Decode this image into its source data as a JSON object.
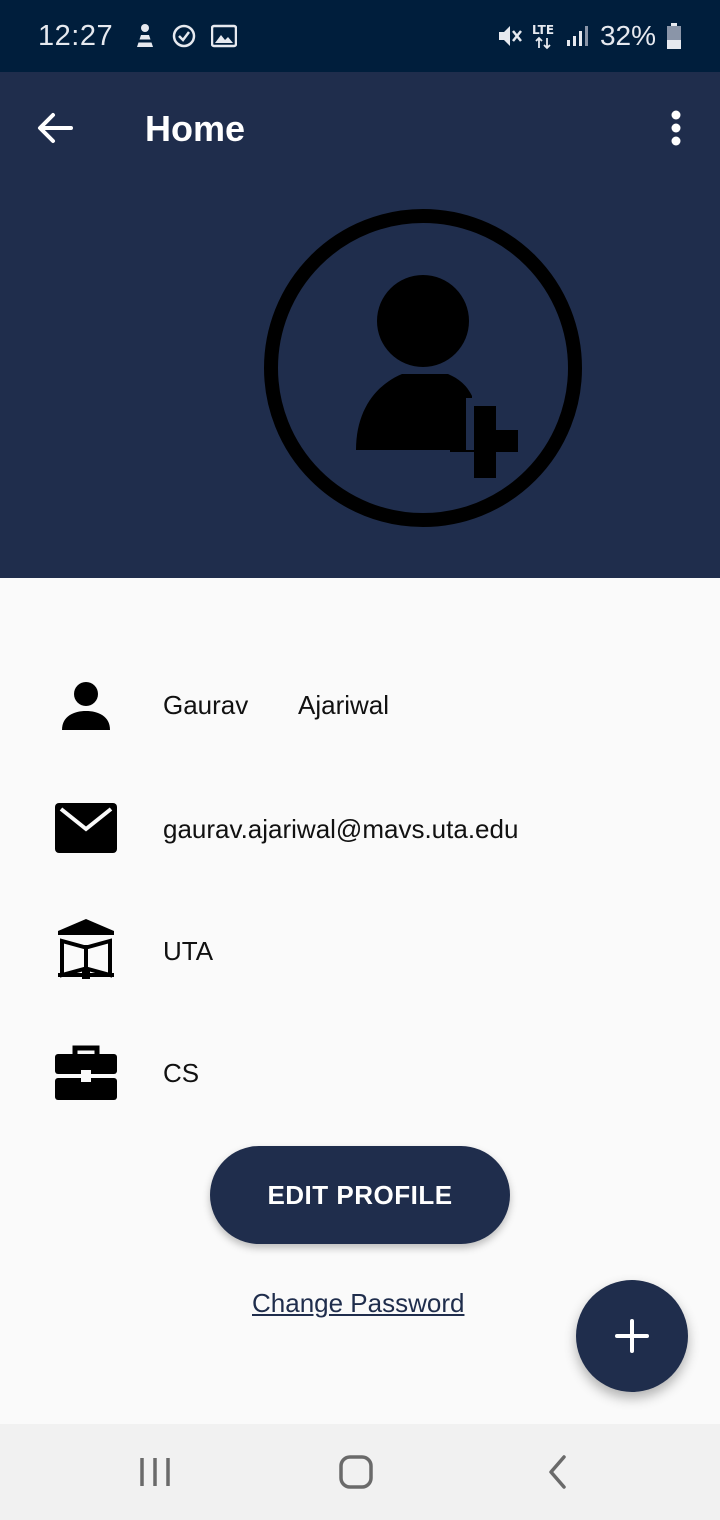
{
  "status_bar": {
    "time": "12:27",
    "battery_percent": "32%",
    "network": "LTE",
    "icons": [
      "wellness-icon",
      "clock-icon",
      "gallery-icon",
      "mute-icon",
      "lte-icon",
      "signal-icon",
      "battery-icon"
    ]
  },
  "app_bar": {
    "title": "Home",
    "back_icon": "arrow-left-icon",
    "menu_icon": "more-vert-icon"
  },
  "profile": {
    "avatar_icon": "add-person-icon",
    "first_name": "Gaurav",
    "last_name": "Ajariwal",
    "email": "gaurav.ajariwal@mavs.uta.edu",
    "university": "UTA",
    "department": "CS"
  },
  "actions": {
    "edit_profile_label": "EDIT PROFILE",
    "change_password_label": "Change Password",
    "fab_icon": "plus-icon"
  },
  "nav": {
    "items": [
      "recents-icon",
      "home-icon",
      "back-icon"
    ]
  },
  "colors": {
    "primary": "#1f2d4c",
    "status_bar": "#001e3c",
    "background": "#fafafa",
    "nav_bar": "#f1f1f1"
  }
}
